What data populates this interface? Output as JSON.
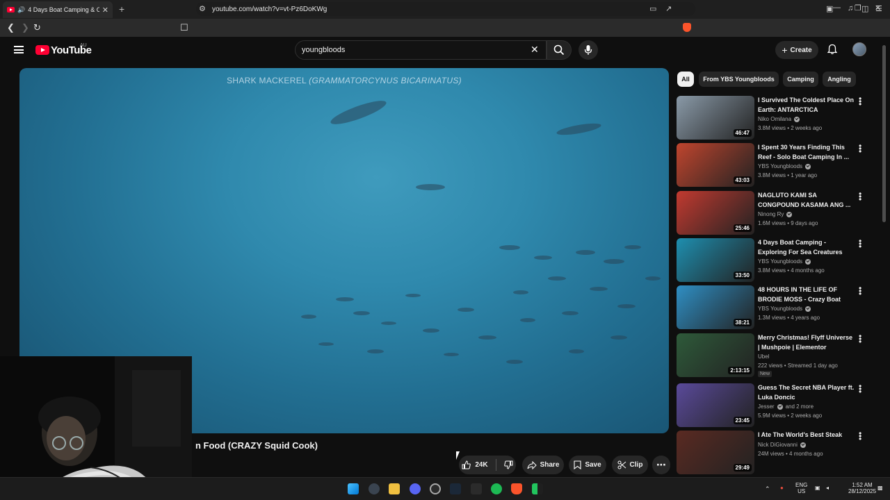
{
  "browser": {
    "tab_title": "4 Days Boat Camping & Catc",
    "url": "youtube.com/watch?v=vt-Pz6DoKWg"
  },
  "header": {
    "logo_text": "YouTube",
    "region": "AU",
    "search_value": "youngbloods",
    "create_label": "Create"
  },
  "player": {
    "caption_main": "SHARK MACKEREL ",
    "caption_italic": "(GRAMMATORCYNUS BICARINATUS)"
  },
  "video": {
    "title_fragment": "n Food (CRAZY Squid Cook)",
    "like_count": "24K",
    "share_label": "Share",
    "save_label": "Save",
    "clip_label": "Clip"
  },
  "chips": [
    "All",
    "From YBS Youngbloods",
    "Camping",
    "Angling"
  ],
  "recommendations": [
    {
      "title": "I Survived The Coldest Place On Earth: ANTARCTICA",
      "channel": "Niko Omilana",
      "verified": true,
      "meta": "3.8M views • 2 weeks ago",
      "duration": "46:47",
      "new": false
    },
    {
      "title": "I Spent 30 Years Finding This Reef - Solo Boat Camping In ...",
      "channel": "YBS Youngbloods",
      "verified": true,
      "meta": "3.8M views • 1 year ago",
      "duration": "43:03",
      "new": false
    },
    {
      "title": "NAGLUTO KAMI SA CONGPOUND KASAMA ANG ...",
      "channel": "Ninong Ry",
      "verified": true,
      "meta": "1.6M views • 9 days ago",
      "duration": "25:46",
      "new": false
    },
    {
      "title": "4 Days Boat Camping - Exploring For Sea Creatures",
      "channel": "YBS Youngbloods",
      "verified": true,
      "meta": "3.8M views • 4 months ago",
      "duration": "33:50",
      "new": false
    },
    {
      "title": "48 HOURS IN THE LIFE OF BRODIE MOSS - Crazy Boat Tri...",
      "channel": "YBS Youngbloods",
      "verified": true,
      "meta": "1.3M views • 4 years ago",
      "duration": "38:21",
      "new": false
    },
    {
      "title": "Merry Christmas! Flyff Universe | Mushpoie | Elementor",
      "channel": "Ubel",
      "verified": false,
      "meta": "222 views • Streamed 1 day ago",
      "duration": "2:13:15",
      "new": true,
      "new_label": "New"
    },
    {
      "title": "Guess The Secret NBA Player ft. Luka Doncic",
      "channel": "Jesser",
      "verified": true,
      "channel_extra": "and 2 more",
      "meta": "5.9M views • 2 weeks ago",
      "duration": "23:45",
      "new": false
    },
    {
      "title": "I Ate The World's Best Steak",
      "channel": "Nick DiGiovanni",
      "verified": true,
      "meta": "24M views • 4 months ago",
      "duration": "29:49",
      "new": false
    }
  ],
  "thumb_colors": [
    "#8a9aa8",
    "#c0452e",
    "#c23a30",
    "#1e8fb0",
    "#2f8fc4",
    "#2e5a3a",
    "#5a4a9a",
    "#5a2a22"
  ],
  "taskbar": {
    "lang_top": "ENG",
    "lang_bottom": "US",
    "time": "1:52 AM",
    "date": "28/12/2025"
  },
  "colors": {
    "youtube_red": "#ff0033",
    "background": "#0f0f0f",
    "chip": "#272727"
  }
}
